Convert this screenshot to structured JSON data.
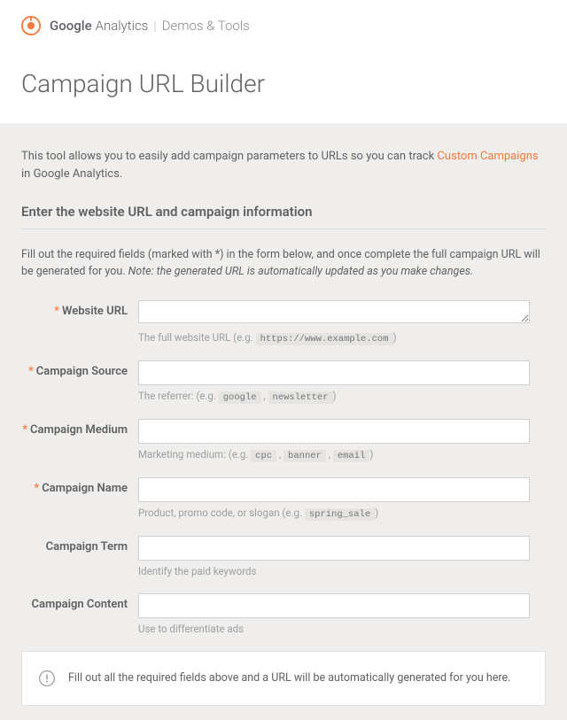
{
  "header": {
    "brand_google": "Google",
    "brand_analytics": "Analytics",
    "separator": "|",
    "brand_demos": "Demos & Tools"
  },
  "page_title": "Campaign URL Builder",
  "intro": {
    "pre": "This tool allows you to easily add campaign parameters to URLs so you can track ",
    "link": "Custom Campaigns",
    "post": " in Google Analytics."
  },
  "section_heading": "Enter the website URL and campaign information",
  "instructions": {
    "main": "Fill out the required fields (marked with *) in the form below, and once complete the full campaign URL will be generated for you. ",
    "note": "Note: the generated URL is automatically updated as you make changes."
  },
  "fields": {
    "website_url": {
      "label": "Website URL",
      "required": true,
      "value": "",
      "hint_pre": "The full website URL (e.g. ",
      "hint_codes": [
        "https://www.example.com"
      ],
      "hint_post": ")"
    },
    "campaign_source": {
      "label": "Campaign Source",
      "required": true,
      "value": "",
      "hint_pre": "The referrer: (e.g. ",
      "hint_codes": [
        "google",
        "newsletter"
      ],
      "hint_post": ")"
    },
    "campaign_medium": {
      "label": "Campaign Medium",
      "required": true,
      "value": "",
      "hint_pre": "Marketing medium: (e.g. ",
      "hint_codes": [
        "cpc",
        "banner",
        "email"
      ],
      "hint_post": ")"
    },
    "campaign_name": {
      "label": "Campaign Name",
      "required": true,
      "value": "",
      "hint_pre": "Product, promo code, or slogan (e.g. ",
      "hint_codes": [
        "spring_sale"
      ],
      "hint_post": ")"
    },
    "campaign_term": {
      "label": "Campaign Term",
      "required": false,
      "value": "",
      "hint_pre": "Identify the paid keywords",
      "hint_codes": [],
      "hint_post": ""
    },
    "campaign_content": {
      "label": "Campaign Content",
      "required": false,
      "value": "",
      "hint_pre": "Use to differentiate ads",
      "hint_codes": [],
      "hint_post": ""
    }
  },
  "result_message": "Fill out all the required fields above and a URL will be automatically generated for you here.",
  "colors": {
    "accent": "#f5793b",
    "text": "#616161",
    "muted": "#9e9e9e",
    "panel_bg": "#efeeec"
  }
}
